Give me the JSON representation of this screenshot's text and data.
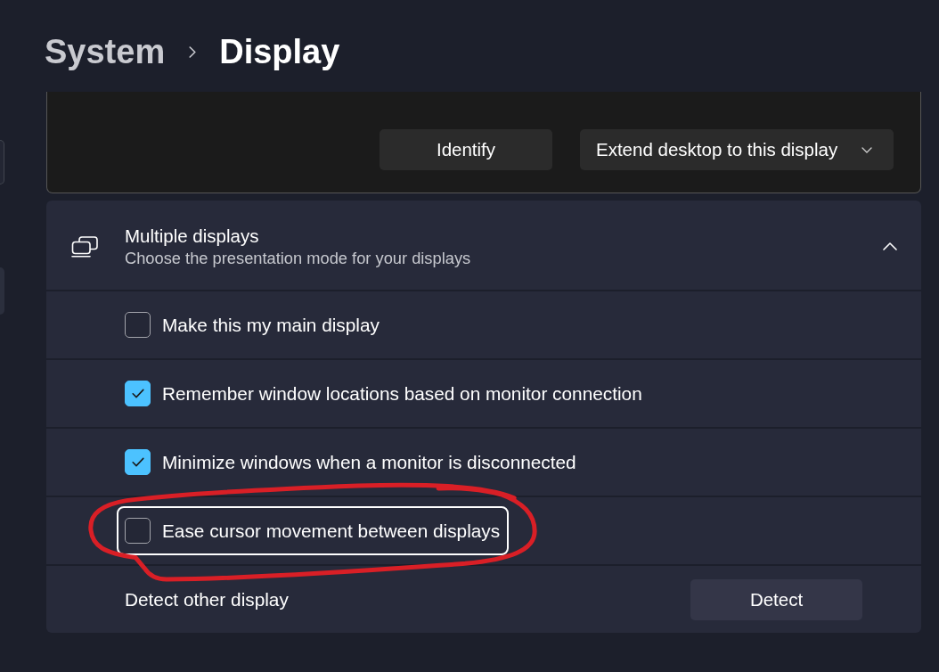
{
  "sidebar": {
    "items": [
      {
        "kind": "field"
      },
      {
        "kind": "item",
        "selected": true
      }
    ]
  },
  "breadcrumb": [
    {
      "label": "System",
      "current": false
    },
    {
      "label": "Display",
      "current": true
    }
  ],
  "display_card": {
    "buttons": [
      {
        "kind": "button",
        "label": "Identify"
      },
      {
        "kind": "dropdown",
        "label": "Extend desktop to this display"
      }
    ]
  },
  "multiple_displays": {
    "title": "Multiple displays",
    "subtitle": "Choose the presentation mode for your displays",
    "expanded": true,
    "options": [
      {
        "label": "Make this my main display",
        "checked": false,
        "focused": false,
        "annotated": false
      },
      {
        "label": "Remember window locations based on monitor connection",
        "checked": true,
        "focused": false,
        "annotated": false
      },
      {
        "label": "Minimize windows when a monitor is disconnected",
        "checked": true,
        "focused": false,
        "annotated": false
      },
      {
        "label": "Ease cursor movement between displays",
        "checked": false,
        "focused": true,
        "annotated": true
      }
    ],
    "detect": {
      "label": "Detect other display",
      "button": "Detect"
    }
  }
}
